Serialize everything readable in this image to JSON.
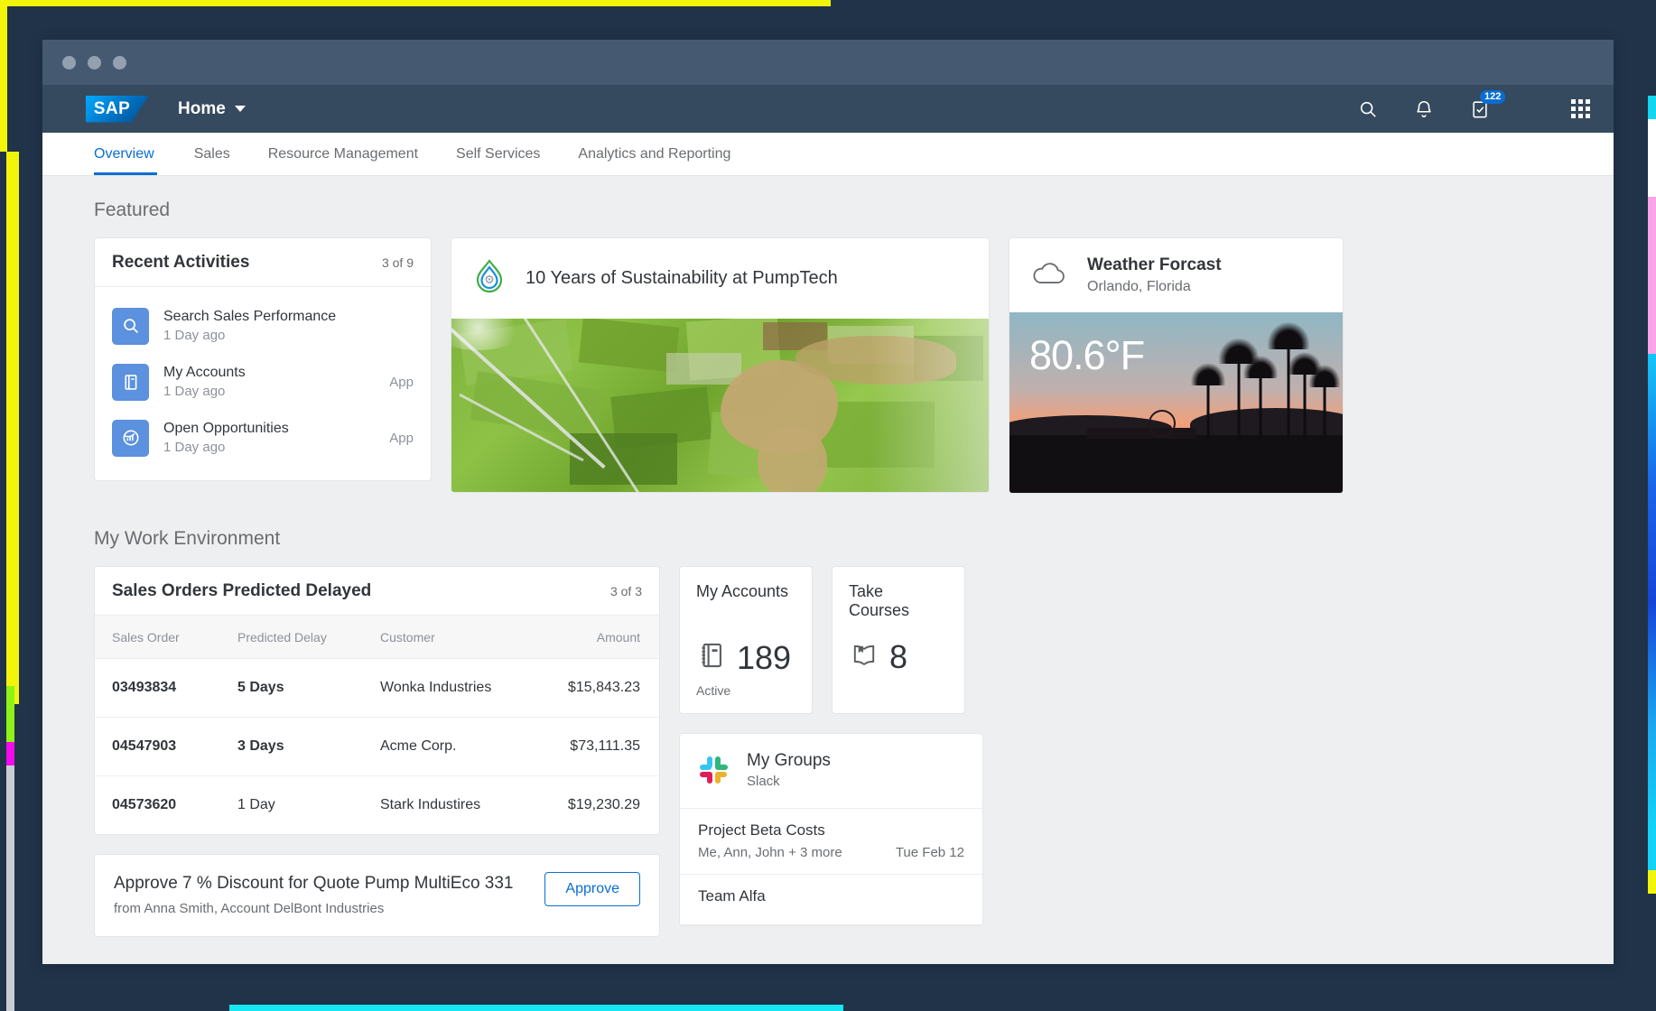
{
  "shell": {
    "logo_text": "SAP",
    "title": "Home",
    "icons": {
      "search": "search-icon",
      "notifications": "bell-icon",
      "tasks": "clipboard-check-icon",
      "tasks_badge": "122",
      "app_grid": "grid-menu-icon"
    }
  },
  "nav": {
    "tabs": [
      {
        "label": "Overview",
        "active": true
      },
      {
        "label": "Sales",
        "active": false
      },
      {
        "label": "Resource Management",
        "active": false
      },
      {
        "label": "Self Services",
        "active": false
      },
      {
        "label": "Analytics and Reporting",
        "active": false
      }
    ]
  },
  "sections": {
    "featured_title": "Featured",
    "work_env_title": "My Work Environment"
  },
  "recent_activities": {
    "title": "Recent Activities",
    "count": "3 of 9",
    "items": [
      {
        "title": "Search Sales Performance",
        "time": "1 Day ago",
        "tag": "",
        "icon": "search-icon"
      },
      {
        "title": "My Accounts",
        "time": "1 Day ago",
        "tag": "App",
        "icon": "notebook-icon"
      },
      {
        "title": "Open Opportunities",
        "time": "1 Day ago",
        "tag": "App",
        "icon": "chart-globe-icon"
      }
    ]
  },
  "sustainability": {
    "title": "10 Years of Sustainability at PumpTech",
    "icon": "water-drop-gear-icon"
  },
  "weather": {
    "title": "Weather Forcast",
    "location": "Orlando, Florida",
    "temperature": "80.6°F",
    "icon": "cloud-icon"
  },
  "sales_orders": {
    "title": "Sales Orders Predicted Delayed",
    "count": "3 of 3",
    "columns": [
      "Sales Order",
      "Predicted Delay",
      "Customer",
      "Amount"
    ],
    "rows": [
      {
        "order": "03493834",
        "delay": "5 Days",
        "delay_critical": true,
        "customer": "Wonka Industries",
        "amount": "$15,843.23"
      },
      {
        "order": "04547903",
        "delay": "3 Days",
        "delay_critical": true,
        "customer": "Acme Corp.",
        "amount": "$73,111.35"
      },
      {
        "order": "04573620",
        "delay": "1 Day",
        "delay_critical": false,
        "customer": "Stark Industires",
        "amount": "$19,230.29"
      }
    ]
  },
  "kpis": [
    {
      "title": "My Accounts",
      "value": "189",
      "footer": "Active",
      "icon": "notebook-icon"
    },
    {
      "title": "Take Courses",
      "value": "8",
      "footer": "",
      "icon": "open-book-icon"
    }
  ],
  "groups": {
    "title": "My Groups",
    "source": "Slack",
    "icon": "slack-logo-icon",
    "items": [
      {
        "title": "Project Beta Costs",
        "members": "Me, Ann, John + 3 more",
        "date": "Tue Feb 12"
      },
      {
        "title": "Team Alfa",
        "members": "",
        "date": ""
      }
    ]
  },
  "approval": {
    "title": "Approve 7 % Discount for Quote Pump MultiEco 331",
    "subtitle": "from Anna Smith, Account DelBont Industries",
    "button": "Approve"
  },
  "colors": {
    "shell_bg": "#354a5f",
    "titlebar_bg": "#455a71",
    "accent_blue": "#0a6ed1",
    "page_bg": "#edeff0",
    "critical_red": "#e4383a",
    "desktop_bg": "#213349"
  }
}
